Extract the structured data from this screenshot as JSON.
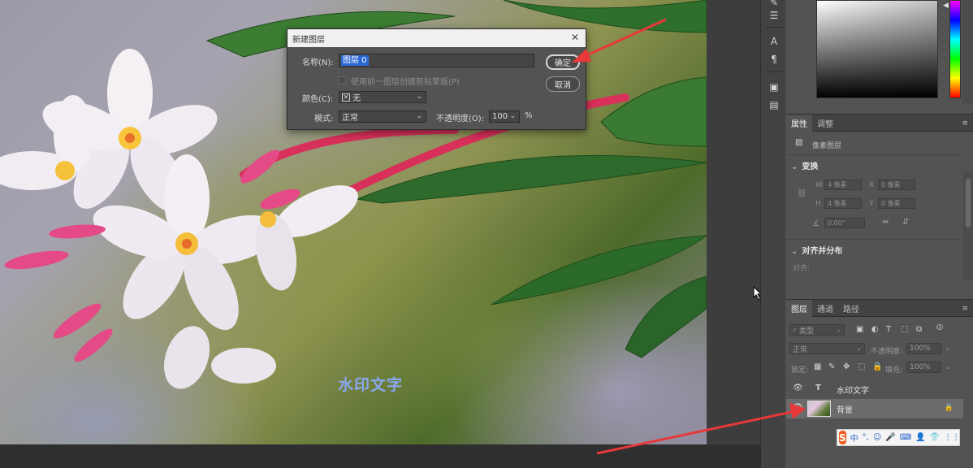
{
  "new_layer_dialog": {
    "title": "新建图层",
    "close_glyph": "✕",
    "name_label": "名称(N):",
    "name_value": "图层 0",
    "clip_label": "使用前一图层创建剪贴蒙版(P)",
    "color_label": "颜色(C):",
    "color_value": "无",
    "mode_label": "模式:",
    "mode_value": "正常",
    "opacity_label": "不透明度(O):",
    "opacity_value": "100",
    "opacity_unit": "%",
    "ok_label": "确定",
    "cancel_label": "取消"
  },
  "canvas": {
    "watermark_text": "水印文字"
  },
  "properties_panel": {
    "tabs": [
      "属性",
      "调整"
    ],
    "layer_type": "像素图层",
    "transform_header": "变换",
    "w_label": "W",
    "w_value": "4 像素",
    "x_label": "X",
    "x_value": "0 像素",
    "h_label": "H",
    "h_value": "4 像素",
    "y_label": "Y",
    "y_value": "0 像素",
    "angle_value": "0.00°",
    "align_header": "对齐并分布",
    "align_label": "对齐:"
  },
  "layers_panel": {
    "tabs": [
      "图层",
      "通道",
      "路径"
    ],
    "filter_kind": "类型",
    "blend_mode": "正常",
    "opacity_label": "不透明度:",
    "opacity_value": "100%",
    "lock_label": "锁定:",
    "fill_label": "填充:",
    "fill_value": "100%",
    "layers": [
      {
        "name": "水印文字",
        "type": "text",
        "visible": true,
        "selected": false
      },
      {
        "name": "背景",
        "type": "pixel",
        "visible": true,
        "selected": true,
        "locked": true
      }
    ]
  },
  "ime_toolbar": {
    "logo": "S",
    "items": [
      "中",
      "°,",
      "☺",
      "🎤",
      "⌨",
      "👤",
      "👕",
      "⋮⋮"
    ]
  },
  "colors": {
    "annotation_arrow": "#e8383a",
    "selection": "#2a66d4",
    "watermark": "#8aa8f2"
  }
}
